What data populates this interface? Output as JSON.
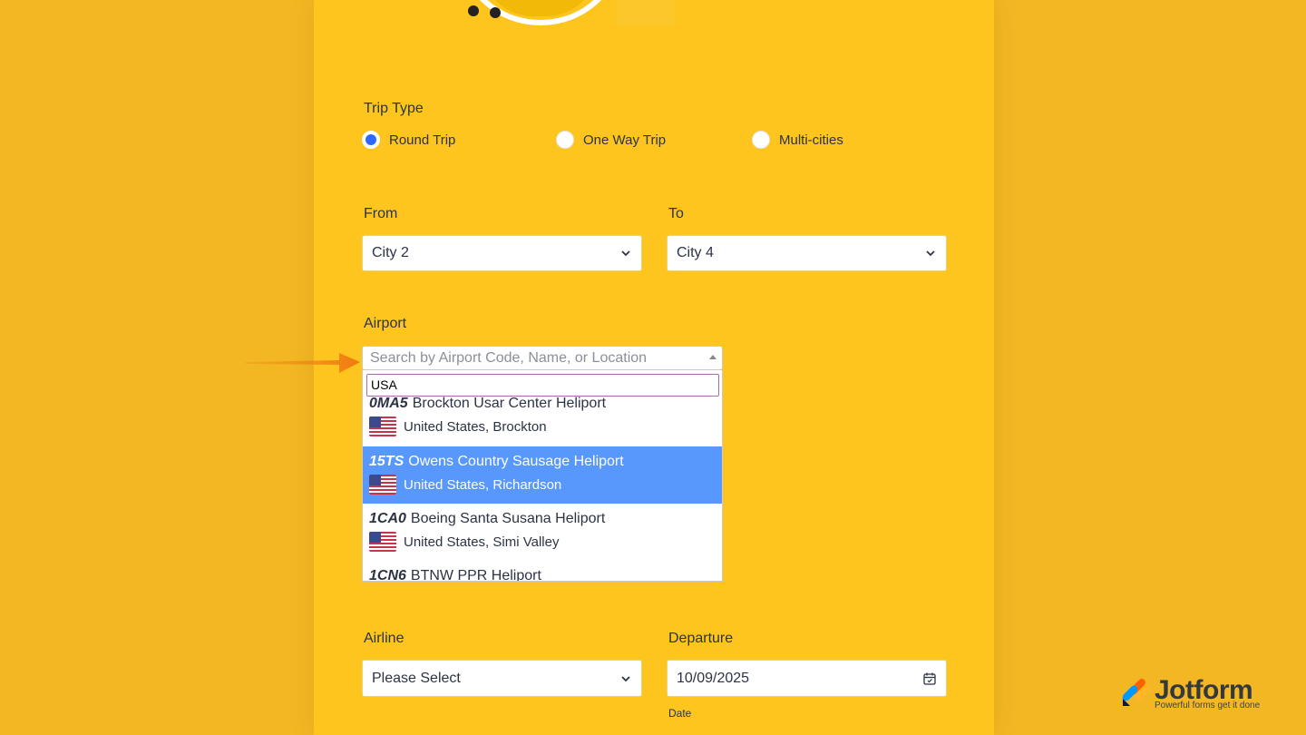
{
  "trip_type": {
    "label": "Trip Type",
    "options": [
      {
        "label": "Round Trip",
        "checked": true
      },
      {
        "label": "One Way Trip",
        "checked": false
      },
      {
        "label": "Multi-cities",
        "checked": false
      }
    ]
  },
  "from": {
    "label": "From",
    "value": "City 2"
  },
  "to": {
    "label": "To",
    "value": "City 4"
  },
  "airport": {
    "label": "Airport",
    "placeholder": "Search by Airport Code, Name, or Location",
    "search_value": "USA",
    "results": [
      {
        "code": "0MA5",
        "name": "Brockton Usar Center Heliport",
        "location": "United States, Brockton"
      },
      {
        "code": "15TS",
        "name": "Owens Country Sausage Heliport",
        "location": "United States, Richardson",
        "highlighted": true
      },
      {
        "code": "1CA0",
        "name": "Boeing Santa Susana Heliport",
        "location": "United States, Simi Valley"
      },
      {
        "code": "1CN6",
        "name": "BTNW PPR Heliport",
        "location": ""
      }
    ]
  },
  "airline": {
    "label": "Airline",
    "value": "Please Select"
  },
  "departure": {
    "label": "Departure",
    "value": "10/09/2025",
    "sublabel": "Date"
  },
  "branding": {
    "name": "Jotform",
    "tagline": "Powerful forms get it done"
  },
  "colors": {
    "accent": "#2e69ff",
    "highlight": "#5897fb",
    "card": "#fdc51e",
    "background": "#f2b722"
  }
}
